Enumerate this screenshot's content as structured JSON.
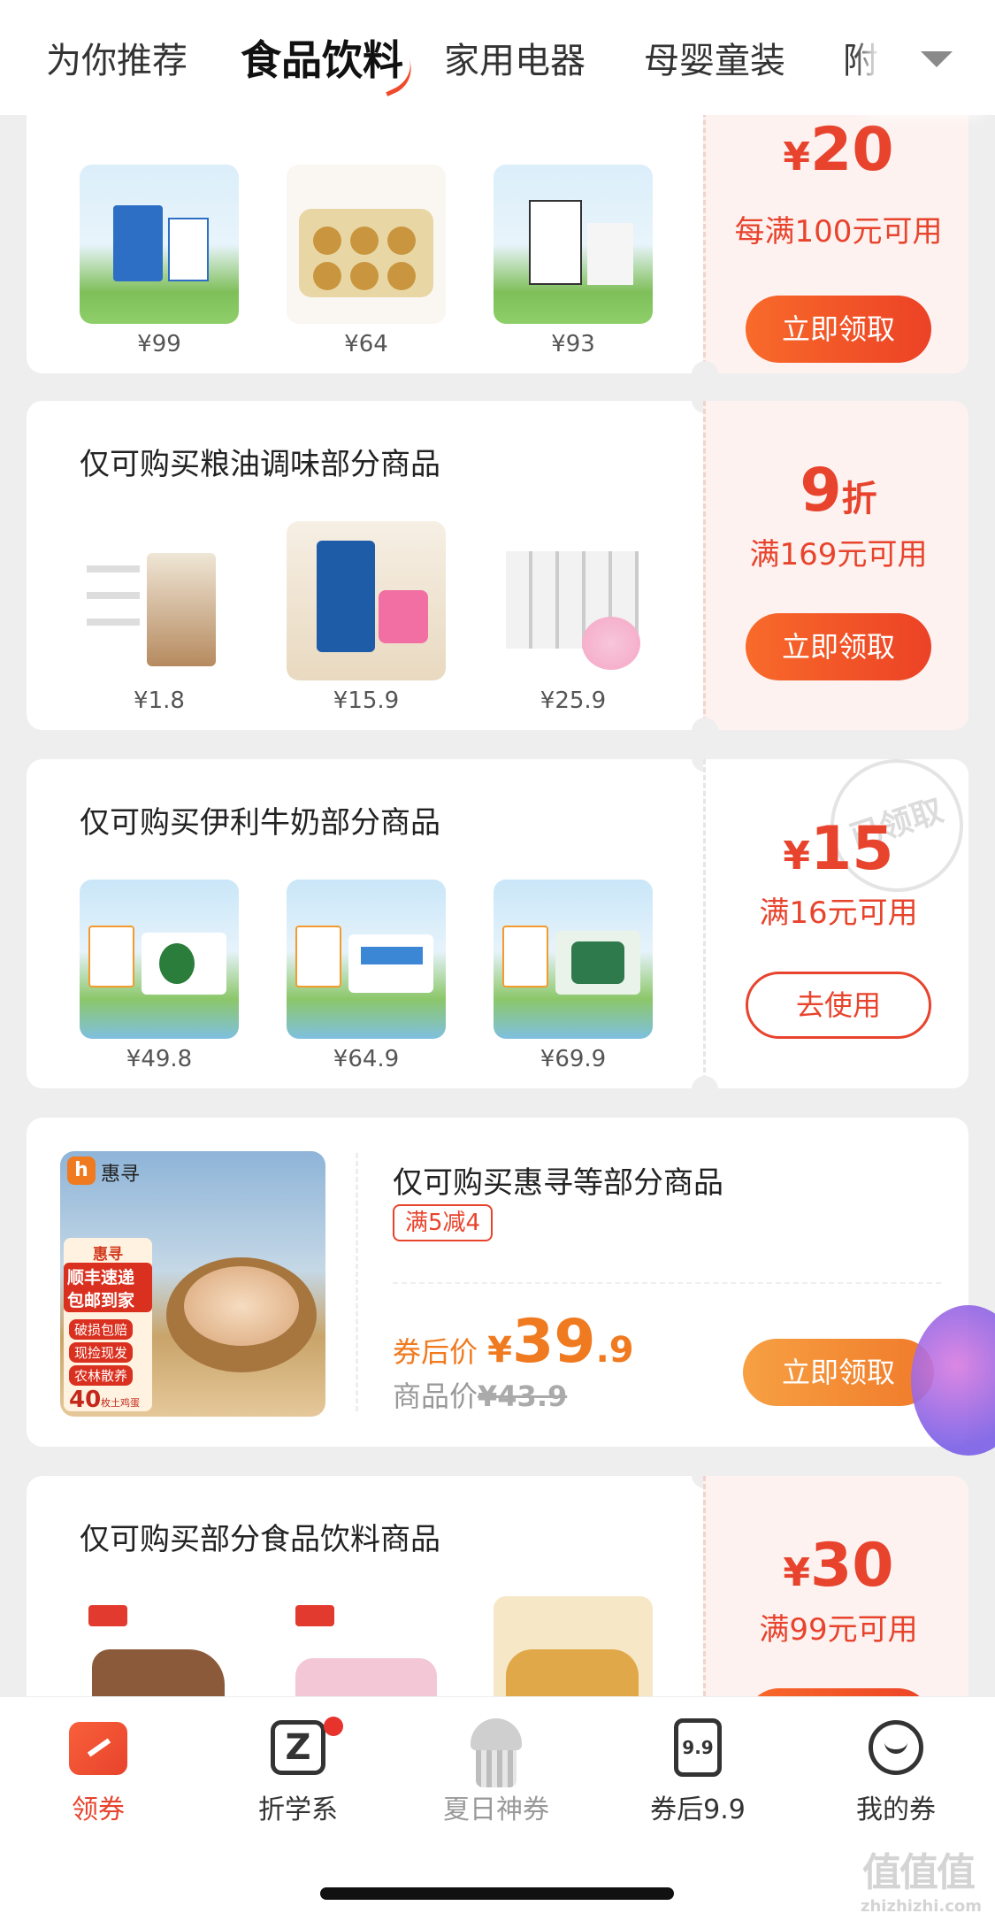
{
  "tabs": {
    "items": [
      {
        "label": "为你推荐"
      },
      {
        "label": "食品饮料"
      },
      {
        "label": "家用电器"
      },
      {
        "label": "母婴童装"
      },
      {
        "label": "附"
      }
    ],
    "active_index": 1
  },
  "coupons": [
    {
      "title": "",
      "products": [
        {
          "price": "¥99"
        },
        {
          "price": "¥64"
        },
        {
          "price": "¥93"
        }
      ],
      "currency": "¥",
      "amount": "20",
      "condition": "每满100元可用",
      "button": "立即领取"
    },
    {
      "title": "仅可购买粮油调味部分商品",
      "products": [
        {
          "price": "¥1.8"
        },
        {
          "price": "¥15.9"
        },
        {
          "price": "¥25.9"
        }
      ],
      "amount": "9",
      "amount_suffix": "折",
      "condition": "满169元可用",
      "button": "立即领取"
    },
    {
      "title": "仅可购买伊利牛奶部分商品",
      "products": [
        {
          "price": "¥49.8"
        },
        {
          "price": "¥64.9"
        },
        {
          "price": "¥69.9"
        }
      ],
      "currency": "¥",
      "amount": "15",
      "condition": "满16元可用",
      "button": "去使用",
      "stamp": "已领取"
    },
    {
      "title": "仅可购买部分食品饮料商品",
      "currency": "¥",
      "amount": "30",
      "condition": "满99元可用"
    }
  ],
  "deal": {
    "brand": "惠寻",
    "title": "仅可购买惠寻等部分商品",
    "tag": "满5减4",
    "after_label": "券后价",
    "after_currency": "¥",
    "after_int": "39",
    "after_dec": ".9",
    "orig_label": "商品价",
    "orig_price": "¥43.9",
    "button": "立即领取",
    "image_text": {
      "brand_small": "惠寻",
      "line1": "顺丰速递",
      "line2": "包邮到家",
      "bullets": [
        "破损包赔",
        "现捡现发",
        "农林散养"
      ],
      "count": "40",
      "count_unit": "枚土鸡蛋"
    }
  },
  "nav": {
    "items": [
      {
        "label": "领券",
        "icon": "coupon-icon"
      },
      {
        "label": "折学系",
        "icon": "zhe-logo-icon"
      },
      {
        "label": "夏日神券",
        "icon": "cake-icon"
      },
      {
        "label": "券后9.9",
        "icon": "ticket-99-icon",
        "icon_text": "9.9"
      },
      {
        "label": "我的券",
        "icon": "smile-icon"
      }
    ]
  },
  "watermark": {
    "glyphs": "值值值",
    "url": "zhizhizhi.com"
  },
  "colors": {
    "accent": "#e8432c",
    "coupon_bg": "#fdf2f0",
    "page_bg": "#eeeeee"
  }
}
